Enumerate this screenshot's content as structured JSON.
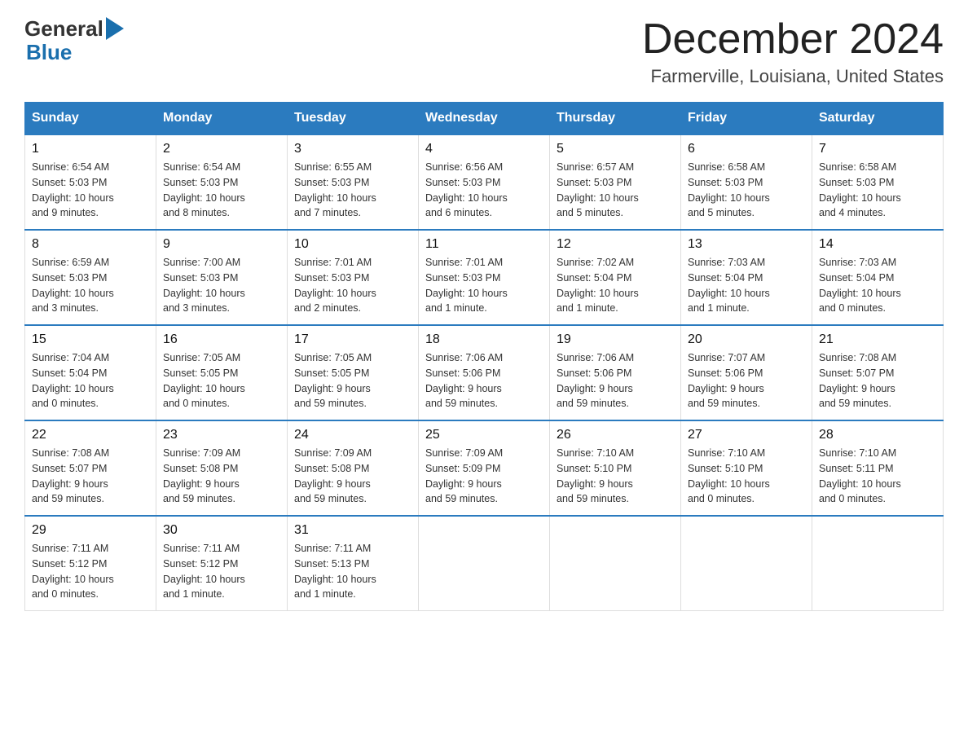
{
  "logo": {
    "general": "General",
    "blue": "Blue",
    "arrow_symbol": "▶"
  },
  "title": "December 2024",
  "subtitle": "Farmerville, Louisiana, United States",
  "days_of_week": [
    "Sunday",
    "Monday",
    "Tuesday",
    "Wednesday",
    "Thursday",
    "Friday",
    "Saturday"
  ],
  "weeks": [
    [
      {
        "day": "1",
        "sunrise": "6:54 AM",
        "sunset": "5:03 PM",
        "daylight": "10 hours and 9 minutes."
      },
      {
        "day": "2",
        "sunrise": "6:54 AM",
        "sunset": "5:03 PM",
        "daylight": "10 hours and 8 minutes."
      },
      {
        "day": "3",
        "sunrise": "6:55 AM",
        "sunset": "5:03 PM",
        "daylight": "10 hours and 7 minutes."
      },
      {
        "day": "4",
        "sunrise": "6:56 AM",
        "sunset": "5:03 PM",
        "daylight": "10 hours and 6 minutes."
      },
      {
        "day": "5",
        "sunrise": "6:57 AM",
        "sunset": "5:03 PM",
        "daylight": "10 hours and 5 minutes."
      },
      {
        "day": "6",
        "sunrise": "6:58 AM",
        "sunset": "5:03 PM",
        "daylight": "10 hours and 5 minutes."
      },
      {
        "day": "7",
        "sunrise": "6:58 AM",
        "sunset": "5:03 PM",
        "daylight": "10 hours and 4 minutes."
      }
    ],
    [
      {
        "day": "8",
        "sunrise": "6:59 AM",
        "sunset": "5:03 PM",
        "daylight": "10 hours and 3 minutes."
      },
      {
        "day": "9",
        "sunrise": "7:00 AM",
        "sunset": "5:03 PM",
        "daylight": "10 hours and 3 minutes."
      },
      {
        "day": "10",
        "sunrise": "7:01 AM",
        "sunset": "5:03 PM",
        "daylight": "10 hours and 2 minutes."
      },
      {
        "day": "11",
        "sunrise": "7:01 AM",
        "sunset": "5:03 PM",
        "daylight": "10 hours and 1 minute."
      },
      {
        "day": "12",
        "sunrise": "7:02 AM",
        "sunset": "5:04 PM",
        "daylight": "10 hours and 1 minute."
      },
      {
        "day": "13",
        "sunrise": "7:03 AM",
        "sunset": "5:04 PM",
        "daylight": "10 hours and 1 minute."
      },
      {
        "day": "14",
        "sunrise": "7:03 AM",
        "sunset": "5:04 PM",
        "daylight": "10 hours and 0 minutes."
      }
    ],
    [
      {
        "day": "15",
        "sunrise": "7:04 AM",
        "sunset": "5:04 PM",
        "daylight": "10 hours and 0 minutes."
      },
      {
        "day": "16",
        "sunrise": "7:05 AM",
        "sunset": "5:05 PM",
        "daylight": "10 hours and 0 minutes."
      },
      {
        "day": "17",
        "sunrise": "7:05 AM",
        "sunset": "5:05 PM",
        "daylight": "9 hours and 59 minutes."
      },
      {
        "day": "18",
        "sunrise": "7:06 AM",
        "sunset": "5:06 PM",
        "daylight": "9 hours and 59 minutes."
      },
      {
        "day": "19",
        "sunrise": "7:06 AM",
        "sunset": "5:06 PM",
        "daylight": "9 hours and 59 minutes."
      },
      {
        "day": "20",
        "sunrise": "7:07 AM",
        "sunset": "5:06 PM",
        "daylight": "9 hours and 59 minutes."
      },
      {
        "day": "21",
        "sunrise": "7:08 AM",
        "sunset": "5:07 PM",
        "daylight": "9 hours and 59 minutes."
      }
    ],
    [
      {
        "day": "22",
        "sunrise": "7:08 AM",
        "sunset": "5:07 PM",
        "daylight": "9 hours and 59 minutes."
      },
      {
        "day": "23",
        "sunrise": "7:09 AM",
        "sunset": "5:08 PM",
        "daylight": "9 hours and 59 minutes."
      },
      {
        "day": "24",
        "sunrise": "7:09 AM",
        "sunset": "5:08 PM",
        "daylight": "9 hours and 59 minutes."
      },
      {
        "day": "25",
        "sunrise": "7:09 AM",
        "sunset": "5:09 PM",
        "daylight": "9 hours and 59 minutes."
      },
      {
        "day": "26",
        "sunrise": "7:10 AM",
        "sunset": "5:10 PM",
        "daylight": "9 hours and 59 minutes."
      },
      {
        "day": "27",
        "sunrise": "7:10 AM",
        "sunset": "5:10 PM",
        "daylight": "10 hours and 0 minutes."
      },
      {
        "day": "28",
        "sunrise": "7:10 AM",
        "sunset": "5:11 PM",
        "daylight": "10 hours and 0 minutes."
      }
    ],
    [
      {
        "day": "29",
        "sunrise": "7:11 AM",
        "sunset": "5:12 PM",
        "daylight": "10 hours and 0 minutes."
      },
      {
        "day": "30",
        "sunrise": "7:11 AM",
        "sunset": "5:12 PM",
        "daylight": "10 hours and 1 minute."
      },
      {
        "day": "31",
        "sunrise": "7:11 AM",
        "sunset": "5:13 PM",
        "daylight": "10 hours and 1 minute."
      },
      null,
      null,
      null,
      null
    ]
  ],
  "labels": {
    "sunrise": "Sunrise:",
    "sunset": "Sunset:",
    "daylight": "Daylight:"
  }
}
